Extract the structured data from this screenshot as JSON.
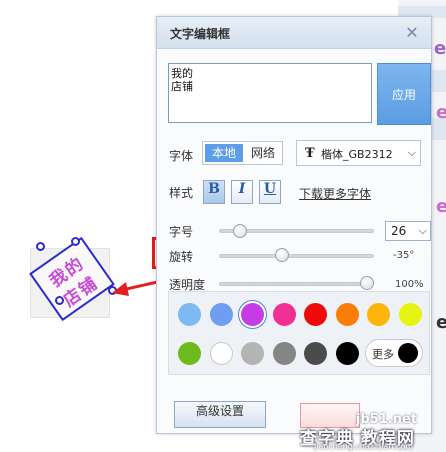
{
  "dialog": {
    "title": "文字编辑框",
    "close_icon": "close-x-icon",
    "text_value": "我的\n店铺",
    "apply_label": "应用",
    "font": {
      "label": "字体",
      "source_local": "本地",
      "source_network": "网络",
      "font_icon": "truetype-icon",
      "selected_font": "楷体_GB2312"
    },
    "style": {
      "label": "样式",
      "bold": "B",
      "italic": "I",
      "underline": "U",
      "bold_active": true,
      "download_more_fonts": "下载更多字体"
    },
    "size": {
      "label": "字号",
      "value": "26",
      "slider_fraction": 0.1
    },
    "rotation": {
      "label": "旋转",
      "value_text": "-35°",
      "slider_fraction": 0.4
    },
    "opacity": {
      "label": "透明度",
      "value_text": "100%",
      "slider_fraction": 1.0
    },
    "colors": {
      "row1": [
        "#7cbaf3",
        "#6d9ef3",
        "#c43ce6",
        "#f12f93",
        "#ee0a0a",
        "#fb7d09",
        "#fdb50b",
        "#e6f414"
      ],
      "row2": [
        "#6fba1d",
        "#ffffff",
        "#b4b4b4",
        "#858585",
        "#4b4b4b",
        "#000000"
      ],
      "selected": "#c43ce6",
      "more_label": "更多",
      "more_color": "#000000"
    },
    "advanced_label": "高级设置"
  },
  "stamp": {
    "line1": "我的",
    "line2": "店铺",
    "rotation_deg": -35,
    "text_color": "#c84ad6",
    "border_color": "#2a2ad0"
  },
  "callout_color": "#e41e1e",
  "watermark": {
    "line1": "jb51.net",
    "line2": "查字典 教程网",
    "line3": "jiaocheng.chazidian.com"
  }
}
